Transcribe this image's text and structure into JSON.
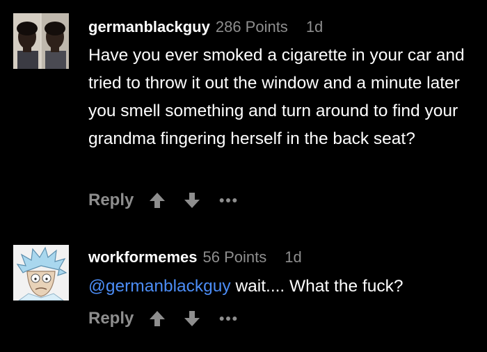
{
  "comments": [
    {
      "username": "germanblackguy",
      "points": "286 Points",
      "age": "1d",
      "text": "Have you ever smoked a cigarette in your car and tried to throw it out the window and a minute later you smell something and turn around to find your grandma fingering herself in the back seat?",
      "reply_label": "Reply",
      "avatar_icon": "two-portraits-avatar"
    },
    {
      "username": "workformemes",
      "points": "56 Points",
      "age": "1d",
      "mention": "@germanblackguy",
      "text": " wait.... What the fuck?",
      "reply_label": "Reply",
      "avatar_icon": "cartoon-scientist-avatar"
    }
  ],
  "icons": {
    "upvote": "arrow-up-icon",
    "downvote": "arrow-down-icon",
    "more": "more-dots-icon"
  },
  "colors": {
    "background": "#000000",
    "text": "#ffffff",
    "muted": "#8e8e8e",
    "mention": "#4c8df6"
  }
}
